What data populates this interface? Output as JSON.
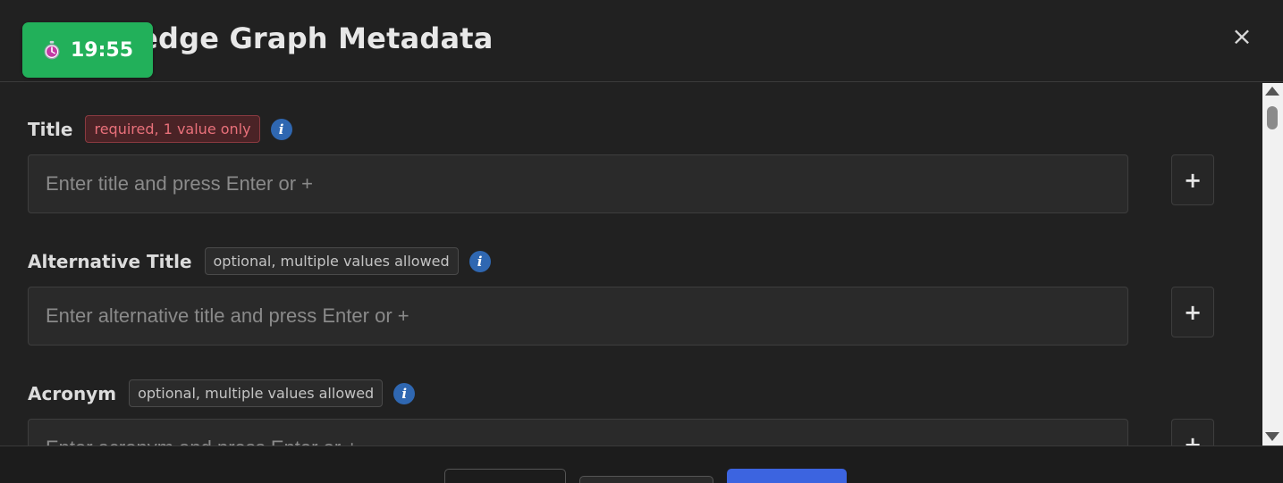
{
  "header": {
    "title": "Knowledge Graph Metadata",
    "close_symbol": "×"
  },
  "timer": {
    "icon": "stopwatch-icon",
    "time": "19:55"
  },
  "fields": [
    {
      "label": "Title",
      "tag": "required, 1 value only",
      "tag_type": "required",
      "placeholder": "Enter title and press Enter or +",
      "add_symbol": "+"
    },
    {
      "label": "Alternative Title",
      "tag": "optional, multiple values allowed",
      "tag_type": "optional",
      "placeholder": "Enter alternative title and press Enter or +",
      "add_symbol": "+"
    },
    {
      "label": "Acronym",
      "tag": "optional, multiple values allowed",
      "tag_type": "optional",
      "placeholder": "Enter acronym and press Enter or +",
      "add_symbol": "+"
    }
  ],
  "info_glyph": "i",
  "colors": {
    "background": "#212121",
    "timer": "#22b05a",
    "required_tag_text": "#e8707a",
    "info": "#2f67b1",
    "primary_button": "#3c64e0"
  }
}
